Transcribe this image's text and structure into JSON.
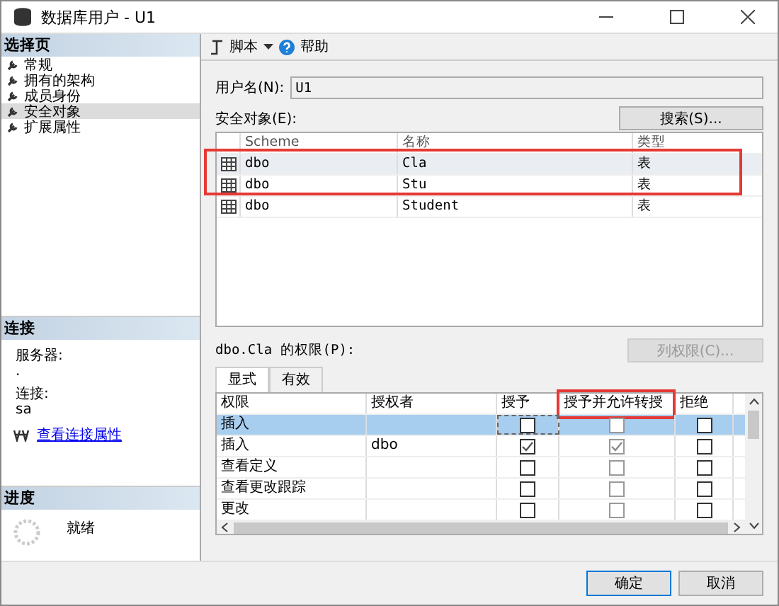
{
  "window": {
    "title": "数据库用户 - U1"
  },
  "sidebar": {
    "header": "选择页",
    "items": [
      {
        "label": "常规",
        "selected": false
      },
      {
        "label": "拥有的架构",
        "selected": false
      },
      {
        "label": "成员身份",
        "selected": false
      },
      {
        "label": "安全对象",
        "selected": true
      },
      {
        "label": "扩展属性",
        "selected": false
      }
    ]
  },
  "connection": {
    "header": "连接",
    "server_label": "服务器:",
    "server": ".",
    "connection_label": "连接:",
    "connection": "sa",
    "link": "查看连接属性"
  },
  "progress": {
    "header": "进度",
    "status": "就绪"
  },
  "toolbar": {
    "script": "脚本",
    "help": "帮助"
  },
  "user_name": {
    "label": "用户名(N):",
    "value": "U1"
  },
  "securables": {
    "label": "安全对象(E):",
    "search_button": "搜索(S)...",
    "columns": [
      "Scheme",
      "名称",
      "类型"
    ],
    "rows": [
      {
        "schema": "dbo",
        "name": "Cla",
        "type": "表",
        "selected": true
      },
      {
        "schema": "dbo",
        "name": "Stu",
        "type": "表",
        "selected": false
      },
      {
        "schema": "dbo",
        "name": "Student",
        "type": "表",
        "selected": false
      }
    ]
  },
  "permissions": {
    "label": "dbo.Cla 的权限(P):",
    "column_button": "列权限(C)...",
    "tabs": [
      {
        "label": "显式",
        "selected": true
      },
      {
        "label": "有效",
        "selected": false
      }
    ],
    "columns": [
      "权限",
      "授权者",
      "授予",
      "授予并允许转授",
      "拒绝"
    ],
    "rows": [
      {
        "permission": "插入",
        "grantor": "",
        "grant": false,
        "with_grant": false,
        "deny": false,
        "selected": true
      },
      {
        "permission": "插入",
        "grantor": "dbo",
        "grant": true,
        "with_grant": true,
        "deny": false,
        "selected": false
      },
      {
        "permission": "查看定义",
        "grantor": "",
        "grant": false,
        "with_grant": false,
        "deny": false,
        "selected": false
      },
      {
        "permission": "查看更改跟踪",
        "grantor": "",
        "grant": false,
        "with_grant": false,
        "deny": false,
        "selected": false
      },
      {
        "permission": "更改",
        "grantor": "",
        "grant": false,
        "with_grant": false,
        "deny": false,
        "selected": false
      }
    ]
  },
  "buttons": [
    "确定",
    "取消"
  ]
}
